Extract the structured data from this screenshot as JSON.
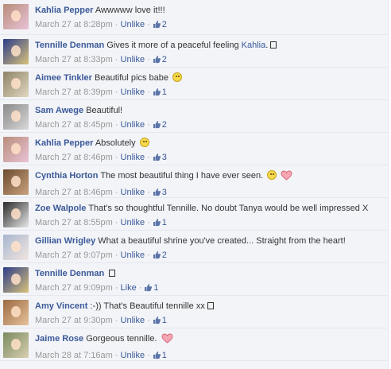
{
  "comments": [
    {
      "author": "Kahlia Pepper",
      "text": "Awwwww love it!!!",
      "mention": "",
      "extras": [],
      "time": "March 27 at 8:28pm",
      "action": "Unlike",
      "likes": "2",
      "avatar": {
        "bg": "#b88c7a",
        "accent": "#e9c3d6"
      }
    },
    {
      "author": "Tennille Denman",
      "text": "Gives it more of a peaceful feeling",
      "mention": "Kahlia",
      "mention_suffix": ".",
      "extras": [
        "box"
      ],
      "time": "March 27 at 8:33pm",
      "action": "Unlike",
      "likes": "2",
      "avatar": {
        "bg": "#2d3d8a",
        "accent": "#d9c27a"
      }
    },
    {
      "author": "Aimee Tinkler",
      "text": "Beautiful pics babe",
      "mention": "",
      "extras": [
        "smile"
      ],
      "time": "March 27 at 8:39pm",
      "action": "Unlike",
      "likes": "1",
      "avatar": {
        "bg": "#8f8468",
        "accent": "#e0d7c0"
      }
    },
    {
      "author": "Sam Awege",
      "text": "Beautiful!",
      "mention": "",
      "extras": [],
      "time": "March 27 at 8:45pm",
      "action": "Unlike",
      "likes": "2",
      "avatar": {
        "bg": "#8a8a8a",
        "accent": "#d8d8d8"
      }
    },
    {
      "author": "Kahlia Pepper",
      "text": "Absolutely",
      "mention": "",
      "extras": [
        "smile"
      ],
      "time": "March 27 at 8:46pm",
      "action": "Unlike",
      "likes": "3",
      "avatar": {
        "bg": "#b88c7a",
        "accent": "#e9c3d6"
      }
    },
    {
      "author": "Cynthia Horton",
      "text": "The most beautiful thing I have ever seen.",
      "mention": "",
      "extras": [
        "smile",
        "heart"
      ],
      "time": "March 27 at 8:46pm",
      "action": "Unlike",
      "likes": "3",
      "avatar": {
        "bg": "#6b4b2f",
        "accent": "#caa27e"
      }
    },
    {
      "author": "Zoe Walpole",
      "text": "That's so thoughtful Tennille. No doubt Tanya would be well impressed X",
      "mention": "",
      "extras": [],
      "time": "March 27 at 8:55pm",
      "action": "Unlike",
      "likes": "1",
      "avatar": {
        "bg": "#2a2a2a",
        "accent": "#e8e8e8"
      }
    },
    {
      "author": "Gillian Wrigley",
      "text": "What a beautiful shrine you've created... Straight from the heart!",
      "mention": "",
      "extras": [],
      "time": "March 27 at 9:07pm",
      "action": "Unlike",
      "likes": "2",
      "avatar": {
        "bg": "#a7b6cf",
        "accent": "#f2e6e0"
      }
    },
    {
      "author": "Tennille Denman",
      "text": "",
      "mention": "",
      "extras": [
        "box"
      ],
      "time": "March 27 at 9:09pm",
      "action": "Like",
      "likes": "1",
      "avatar": {
        "bg": "#2d3d8a",
        "accent": "#d9c27a"
      }
    },
    {
      "author": "Amy Vincent",
      "text": ":-)) That's Beautiful tennille xx",
      "mention": "",
      "extras": [
        "box"
      ],
      "time": "March 27 at 9:30pm",
      "action": "Unlike",
      "likes": "1",
      "avatar": {
        "bg": "#9c6a43",
        "accent": "#e6c29a"
      }
    },
    {
      "author": "Jaime Rose",
      "text": "Gorgeous tennille.",
      "mention": "",
      "extras": [
        "heart"
      ],
      "time": "March 28 at 7:16am",
      "action": "Unlike",
      "likes": "1",
      "avatar": {
        "bg": "#7a8a5e",
        "accent": "#d8cfb0"
      }
    }
  ],
  "colors": {
    "link": "#3b5998",
    "meta": "#999999",
    "heart": "#f07a8c"
  },
  "icons": {
    "like": "thumbs-up-icon",
    "smile": "smiley-emoji",
    "heart": "heart-emoji"
  }
}
